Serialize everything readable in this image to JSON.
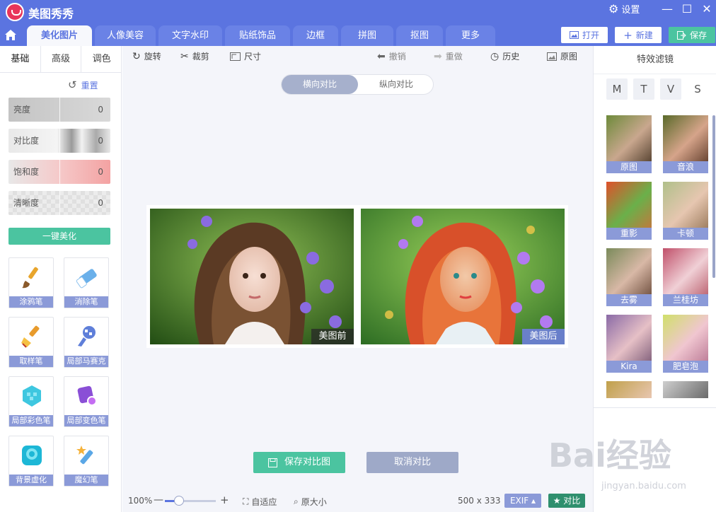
{
  "app": {
    "title": "美图秀秀"
  },
  "titlebar": {
    "settings_label": "设置",
    "minimize": "—",
    "maximize": "☐",
    "close": "✕"
  },
  "tabs": [
    {
      "label": "美化图片",
      "active": true
    },
    {
      "label": "人像美容",
      "active": false
    },
    {
      "label": "文字水印",
      "active": false
    },
    {
      "label": "贴纸饰品",
      "active": false
    },
    {
      "label": "边框",
      "active": false
    },
    {
      "label": "拼图",
      "active": false
    },
    {
      "label": "抠图",
      "active": false
    },
    {
      "label": "更多",
      "active": false
    }
  ],
  "top_buttons": {
    "open": "打开",
    "new": "新建",
    "save": "保存"
  },
  "left_panel": {
    "sub_tabs": [
      "基础",
      "高级",
      "调色"
    ],
    "reset_label": "重置",
    "adjustments": [
      {
        "label": "亮度",
        "value": "0"
      },
      {
        "label": "对比度",
        "value": "0"
      },
      {
        "label": "饱和度",
        "value": "0"
      },
      {
        "label": "清晰度",
        "value": "0"
      }
    ],
    "one_key_label": "一键美化",
    "tools": [
      {
        "label": "涂鸦笔",
        "icon": "brush-icon"
      },
      {
        "label": "消除笔",
        "icon": "eraser-icon"
      },
      {
        "label": "取样笔",
        "icon": "sample-brush-icon"
      },
      {
        "label": "局部马赛克",
        "icon": "mosaic-pen-icon"
      },
      {
        "label": "局部彩色笔",
        "icon": "color-pen-icon"
      },
      {
        "label": "局部变色笔",
        "icon": "recolor-pen-icon"
      },
      {
        "label": "背景虚化",
        "icon": "blur-icon"
      },
      {
        "label": "魔幻笔",
        "icon": "magic-pen-icon"
      }
    ]
  },
  "toolbar": {
    "rotate": "旋转",
    "crop": "裁剪",
    "size": "尺寸",
    "undo": "撤销",
    "redo": "重做",
    "history": "历史",
    "original": "原图"
  },
  "compare": {
    "horizontal": "横向对比",
    "vertical": "纵向对比",
    "before_tag": "美图前",
    "after_tag": "美图后",
    "save_label": "保存对比图",
    "cancel_label": "取消对比"
  },
  "statusbar": {
    "zoom": "100%",
    "fit_label": "自适应",
    "original_size_label": "原大小",
    "dimensions": "500 x 333",
    "exif_label": "EXIF",
    "compare_label": "对比"
  },
  "right_panel": {
    "title": "特效滤镜",
    "categories": [
      "M",
      "T",
      "V",
      "S"
    ],
    "filters": [
      "原图",
      "音浪",
      "重影",
      "卡顿",
      "去雾",
      "兰桂坊",
      "Kira",
      "肥皂泡"
    ]
  },
  "watermark": {
    "main": "Bai经验",
    "sub": "jingyan.baidu.com"
  },
  "colors": {
    "primary": "#5b74e0",
    "accent_green": "#4bc4a0",
    "label_bg": "#8b9ad8"
  }
}
